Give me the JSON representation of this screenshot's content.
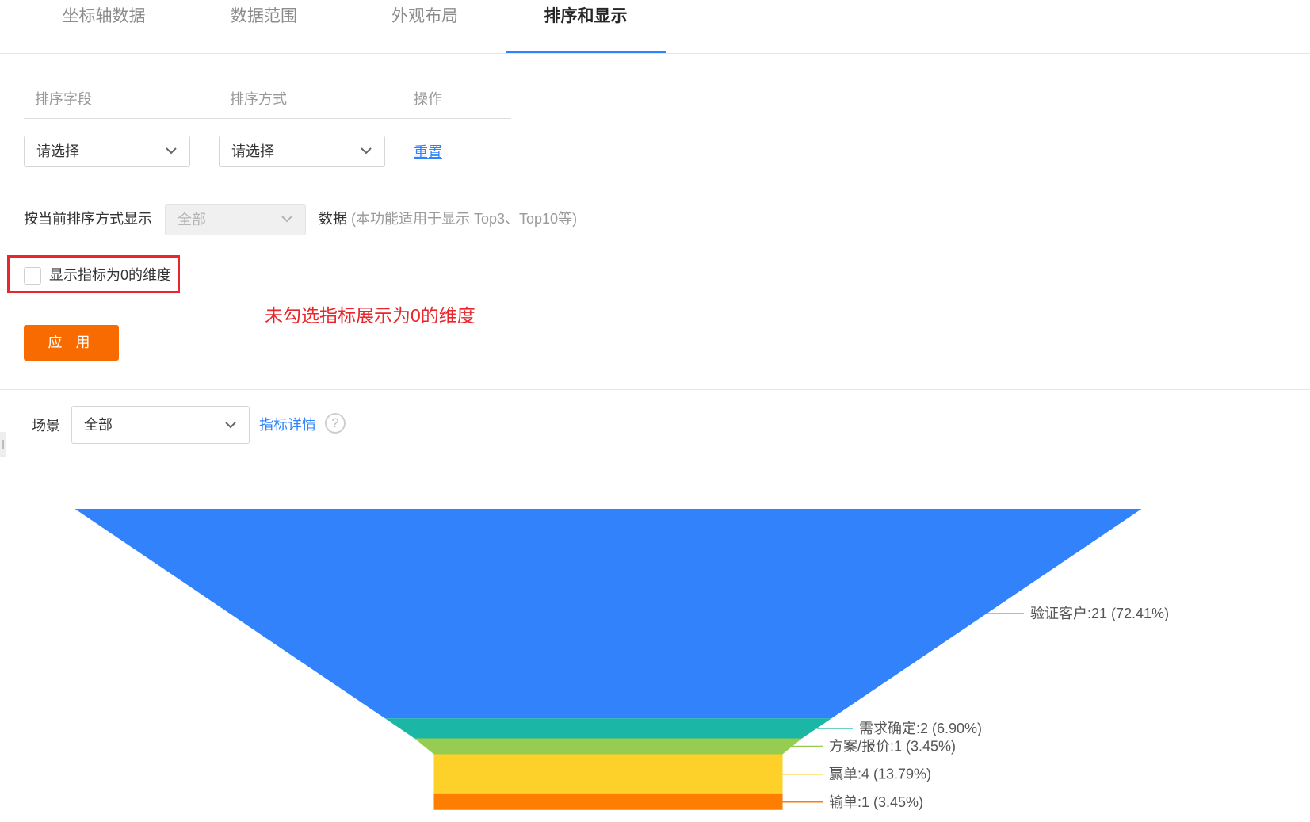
{
  "tabs": [
    {
      "label": "坐标轴数据",
      "active": false
    },
    {
      "label": "数据范围",
      "active": false
    },
    {
      "label": "外观布局",
      "active": false
    },
    {
      "label": "排序和显示",
      "active": true
    }
  ],
  "sort_table": {
    "headers": {
      "field": "排序字段",
      "method": "排序方式",
      "action": "操作"
    },
    "field_select": "请选择",
    "method_select": "请选择",
    "reset_link": "重置"
  },
  "display": {
    "prefix": "按当前排序方式显示",
    "select_value": "全部",
    "suffix": "数据",
    "hint": "(本功能适用于显示 Top3、Top10等)"
  },
  "zero_dimension": {
    "label": "显示指标为0的维度",
    "checked": false
  },
  "annotation": "未勾选指标展示为0的维度",
  "apply_button": "应 用",
  "scene": {
    "label": "场景",
    "select_value": "全部",
    "metric_link": "指标详情",
    "help_glyph": "?"
  },
  "colors": {
    "accent": "#2e82ff",
    "apply": "#f76b00",
    "annotation": "#e8262b"
  },
  "chart_data": {
    "type": "funnel",
    "stages": [
      {
        "name": "验证客户",
        "value": 21,
        "percent": "72.41%",
        "label": "验证客户:21 (72.41%)",
        "color": "#3182fb"
      },
      {
        "name": "需求确定",
        "value": 2,
        "percent": "6.90%",
        "label": "需求确定:2 (6.90%)",
        "color": "#1bb6a5"
      },
      {
        "name": "方案/报价",
        "value": 1,
        "percent": "3.45%",
        "label": "方案/报价:1 (3.45%)",
        "color": "#96cd50"
      },
      {
        "name": "赢单",
        "value": 4,
        "percent": "13.79%",
        "label": "赢单:4 (13.79%)",
        "color": "#fed12a"
      },
      {
        "name": "输单",
        "value": 1,
        "percent": "3.45%",
        "label": "输单:1 (3.45%)",
        "color": "#fd7e00"
      }
    ]
  }
}
